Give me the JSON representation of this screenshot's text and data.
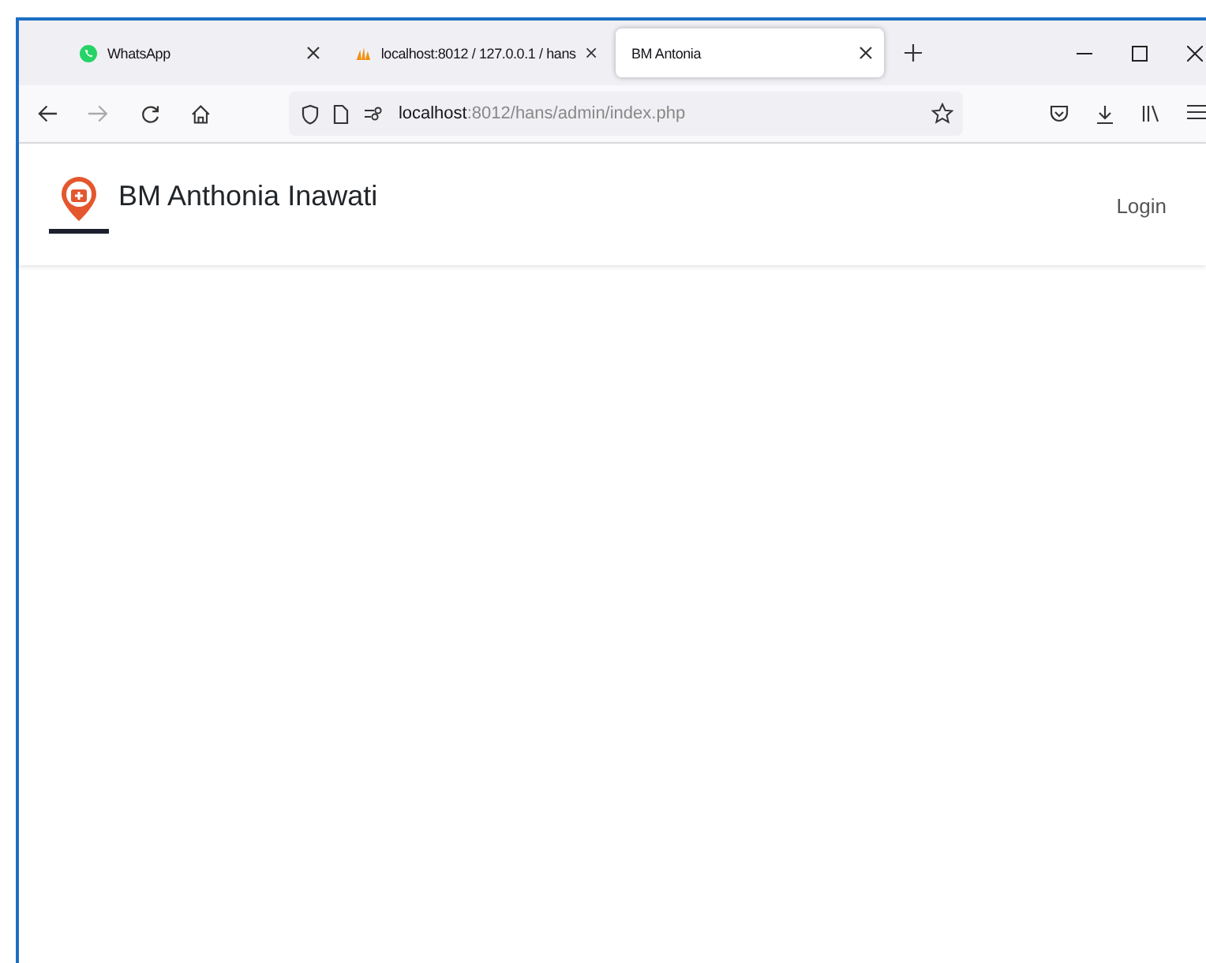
{
  "tabs": [
    {
      "title": "WhatsApp",
      "kind": "whatsapp",
      "selected": false
    },
    {
      "title": "localhost:8012 / 127.0.0.1 / hans",
      "kind": "pma",
      "selected": false
    },
    {
      "title": "BM Antonia",
      "selected": true
    }
  ],
  "address_bar": {
    "host": "localhost",
    "path": ":8012/hans/admin/index.php"
  },
  "page": {
    "brand": "BM Anthonia Inawati",
    "nav": [
      "Login"
    ]
  }
}
